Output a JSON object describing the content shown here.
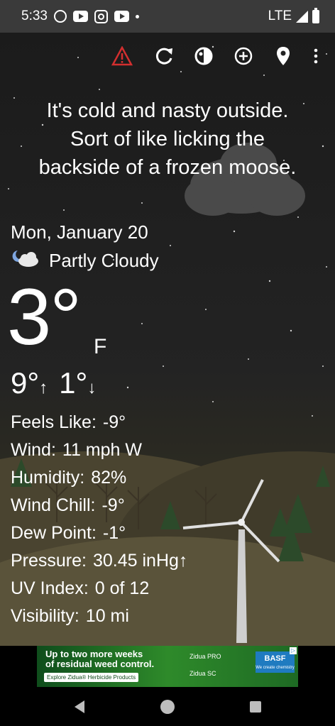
{
  "status_bar": {
    "time": "5:33",
    "network": "LTE",
    "icons": [
      "alarm-icon",
      "youtube-icon",
      "instagram-icon",
      "youtube-icon",
      "dot-icon",
      "signal-icon",
      "battery-icon"
    ]
  },
  "toolbar": {
    "icons": [
      "warning-icon",
      "refresh-icon",
      "theme-icon",
      "add-location-icon",
      "location-icon",
      "more-icon"
    ],
    "warning_color": "#d32f2f"
  },
  "message": {
    "line1": "It's cold and nasty outside.",
    "line2": "Sort of like licking the",
    "line3": "backside of a frozen moose."
  },
  "weather": {
    "date": "Mon, January 20",
    "condition": "Partly Cloudy",
    "condition_icon": "partly-cloudy-night-icon",
    "temperature": "3°",
    "unit": "F",
    "high": "9°",
    "low": "1°",
    "high_arrow": "↑",
    "low_arrow": "↓"
  },
  "details": [
    {
      "label": "Feels Like:",
      "value": "-9°"
    },
    {
      "label": "Wind:",
      "value": "11 mph W"
    },
    {
      "label": "Humidity:",
      "value": "82%"
    },
    {
      "label": "Wind Chill:",
      "value": "-9°"
    },
    {
      "label": "Dew Point:",
      "value": "-1°"
    },
    {
      "label": "Pressure:",
      "value": "30.45 inHg↑"
    },
    {
      "label": "UV Index:",
      "value": "0 of 12"
    },
    {
      "label": "Visibility:",
      "value": "10 mi"
    }
  ],
  "ad": {
    "headline1": "Up to two more weeks",
    "headline2": "of residual weed control.",
    "cta": "Explore Zidua® Herbicide Products",
    "product1": "Zidua PRO",
    "product2": "Zidua SC",
    "brand": "BASF",
    "brand_tagline": "We create chemistry"
  },
  "nav_bar": {
    "icons": [
      "back-icon",
      "home-icon",
      "recents-icon"
    ]
  }
}
